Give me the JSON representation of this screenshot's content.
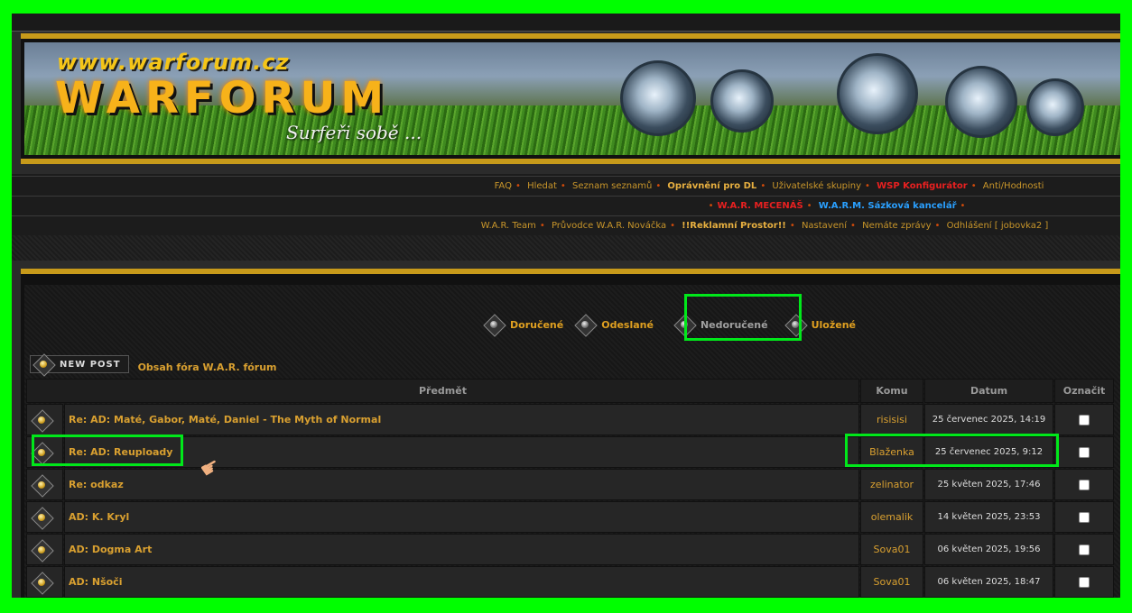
{
  "banner": {
    "url_text": "www.warforum.cz",
    "logo_text": "WARFORUM",
    "slogan": "Surfeři sobě ..."
  },
  "nav": {
    "row1": [
      "FAQ",
      "Hledat",
      "Seznam seznamů",
      "Oprávnění pro DL",
      "Uživatelské skupiny",
      "WSP Konfigurátor",
      "Anti/Hodnosti"
    ],
    "row2": [
      "W.A.R. MECENÁŠ",
      "W.A.R.M. Sázková kancelář"
    ],
    "row3": [
      "W.A.R. Team",
      "Průvodce W.A.R. Nováčka",
      "!!Reklamní Prostor!!",
      "Nastavení",
      "Nemáte zprávy",
      "Odhlášení [ jobovka2 ]"
    ]
  },
  "folders": [
    "Doručené",
    "Odeslané",
    "Nedoručené",
    "Uložené"
  ],
  "active_folder": "Nedoručené",
  "newpost_label": "NEW POST",
  "breadcrumb": "Obsah fóra W.A.R. fórum",
  "table": {
    "headers": [
      "Předmět",
      "Komu",
      "Datum",
      "Označit"
    ],
    "rows": [
      {
        "subject": "Re: AD: Maté, Gabor, Maté, Daniel - The Myth of Normal",
        "to": "risisisi",
        "date": "25 červenec 2025, 14:19"
      },
      {
        "subject": "Re: AD: Reuploady",
        "to": "Blaženka",
        "date": "25 červenec 2025, 9:12"
      },
      {
        "subject": "Re: odkaz",
        "to": "zelinator",
        "date": "25 květen 2025, 17:46"
      },
      {
        "subject": "AD: K. Kryl",
        "to": "olemalik",
        "date": "14 květen 2025, 23:53"
      },
      {
        "subject": "AD: Dogma Art",
        "to": "Sova01",
        "date": "06 květen 2025, 19:56"
      },
      {
        "subject": "AD: Nšoči",
        "to": "Sova01",
        "date": "06 květen 2025, 18:47"
      }
    ]
  },
  "colors": {
    "highlight": "#00e81a",
    "accent": "#c79a1a",
    "link": "#d9a030"
  }
}
